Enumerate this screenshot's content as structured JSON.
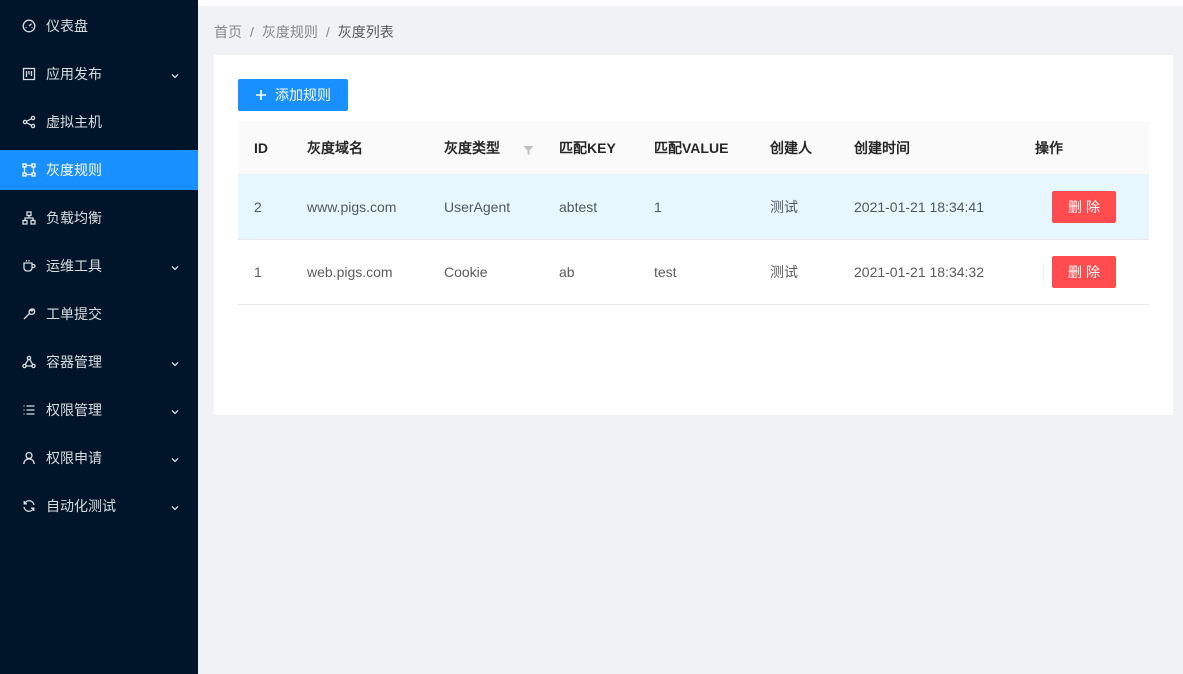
{
  "sidebar": {
    "items": [
      {
        "label": "仪表盘",
        "icon": "dashboard-icon",
        "expandable": false
      },
      {
        "label": "应用发布",
        "icon": "project-icon",
        "expandable": true
      },
      {
        "label": "虚拟主机",
        "icon": "share-nodes-icon",
        "expandable": false
      },
      {
        "label": "灰度规则",
        "icon": "node-frame-icon",
        "expandable": false,
        "active": true
      },
      {
        "label": "负载均衡",
        "icon": "cluster-icon",
        "expandable": false
      },
      {
        "label": "运维工具",
        "icon": "coffee-cup-icon",
        "expandable": true
      },
      {
        "label": "工单提交",
        "icon": "wrench-icon",
        "expandable": false
      },
      {
        "label": "容器管理",
        "icon": "deployment-icon",
        "expandable": true
      },
      {
        "label": "权限管理",
        "icon": "list-icon",
        "expandable": true
      },
      {
        "label": "权限申请",
        "icon": "user-icon",
        "expandable": true
      },
      {
        "label": "自动化测试",
        "icon": "sync-icon",
        "expandable": true
      }
    ],
    "bg_color": "#001529",
    "active_color": "#1890ff"
  },
  "breadcrumb": {
    "items": [
      "首页",
      "灰度规则",
      "灰度列表"
    ],
    "separator": "/"
  },
  "toolbar": {
    "add_label": "添加规则"
  },
  "table": {
    "columns": [
      "ID",
      "灰度域名",
      "灰度类型",
      "匹配KEY",
      "匹配VALUE",
      "创建人",
      "创建时间",
      "操作"
    ],
    "rows": [
      {
        "id": "2",
        "domain": "www.pigs.com",
        "type": "UserAgent",
        "key": "abtest",
        "value": "1",
        "creator": "测试",
        "created": "2021-01-21 18:34:41",
        "action": "删除"
      },
      {
        "id": "1",
        "domain": "web.pigs.com",
        "type": "Cookie",
        "key": "ab",
        "value": "test",
        "creator": "测试",
        "created": "2021-01-21 18:34:32",
        "action": "删除"
      }
    ]
  },
  "colors": {
    "primary": "#1890ff",
    "danger": "#ff4d4f",
    "row_hover": "#e6f7ff"
  }
}
